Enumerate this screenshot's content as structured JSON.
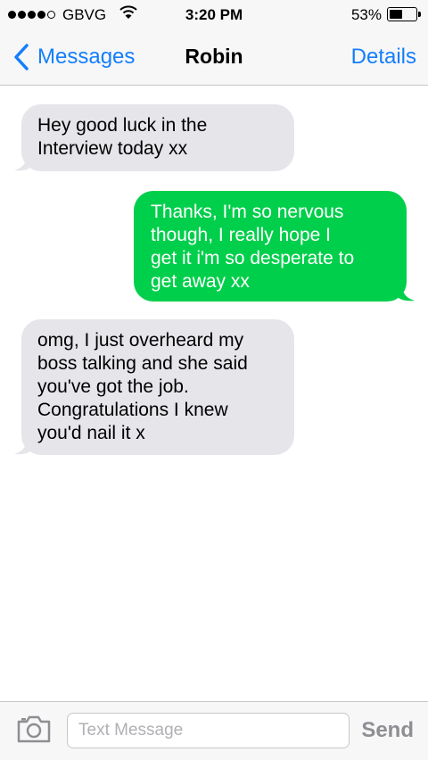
{
  "status_bar": {
    "carrier": "GBVG",
    "time": "3:20 PM",
    "battery_percent": "53%",
    "battery_level": 0.53,
    "signal_bars_filled": 4,
    "signal_bars_total": 5
  },
  "nav": {
    "back_label": "Messages",
    "title": "Robin",
    "details_label": "Details"
  },
  "messages": [
    {
      "direction": "incoming",
      "text": "Hey good luck in the\nInterview today xx"
    },
    {
      "direction": "outgoing",
      "text": "Thanks, I'm so nervous\nthough, I really hope I\nget it i'm so desperate to\nget away xx"
    },
    {
      "direction": "incoming",
      "text": "omg, I just overheard my\nboss talking and she said\nyou've got the job.\nCongratulations I knew\nyou'd nail it x"
    }
  ],
  "composer": {
    "placeholder": "Text Message",
    "value": "",
    "send_label": "Send",
    "camera_icon": "camera-icon"
  },
  "colors": {
    "accent": "#147efb",
    "incoming_bubble": "#e5e5ea",
    "outgoing_bubble": "#00cf4b",
    "bar_background": "#f7f7f8"
  }
}
